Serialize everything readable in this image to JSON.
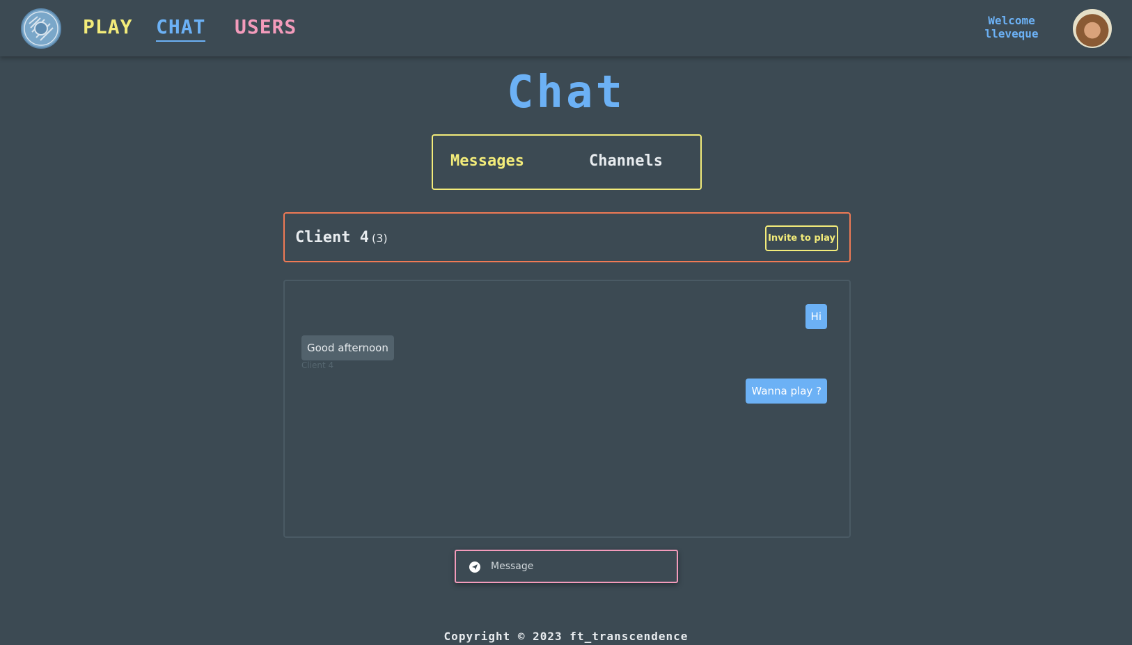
{
  "header": {
    "nav": {
      "play": "PLAY",
      "chat": "CHAT",
      "users": "USERS"
    },
    "welcome_line1": "Welcome",
    "welcome_line2": "lleveque"
  },
  "page": {
    "title": "Chat"
  },
  "tabs": {
    "messages": "Messages",
    "channels": "Channels"
  },
  "conversation": {
    "name": "Client 4",
    "count": "(3)",
    "invite_label": "Invite to play"
  },
  "messages": [
    {
      "text": "Hi",
      "from_me": true
    },
    {
      "text": "Good afternoon",
      "from_me": false,
      "sender": "Client 4"
    },
    {
      "text": "Wanna play ?",
      "from_me": true
    }
  ],
  "composer": {
    "placeholder": "Message"
  },
  "footer": {
    "text": "Copyright © 2023 ft_transcendence"
  },
  "colors": {
    "background": "#3c4a53",
    "yellow": "#f3ec7a",
    "blue": "#6cb1f5",
    "pink": "#f39bbb",
    "orange": "#f07a55"
  }
}
